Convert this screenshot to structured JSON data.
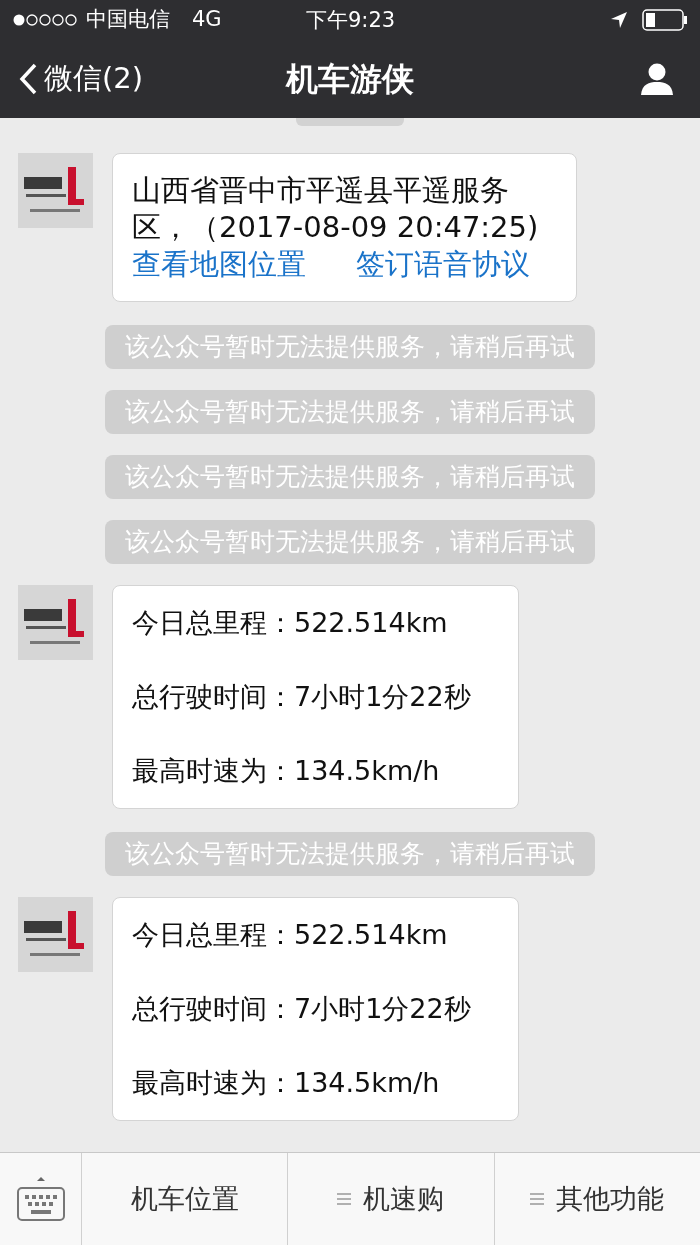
{
  "status_bar": {
    "carrier": "中国电信",
    "network": "4G",
    "time": "下午9:23"
  },
  "nav_bar": {
    "back_label": "微信(2)",
    "title": "机车游侠"
  },
  "messages": [
    {
      "kind": "location",
      "text": "山西省晋中市平遥县平遥服务区，（2017-08-09 20:47:25)",
      "links": [
        "查看地图位置",
        "签订语音协议"
      ]
    },
    {
      "kind": "notice",
      "text": "该公众号暂时无法提供服务，请稍后再试"
    },
    {
      "kind": "notice",
      "text": "该公众号暂时无法提供服务，请稍后再试"
    },
    {
      "kind": "notice",
      "text": "该公众号暂时无法提供服务，请稍后再试"
    },
    {
      "kind": "notice",
      "text": "该公众号暂时无法提供服务，请稍后再试"
    },
    {
      "kind": "stats",
      "lines": [
        "今日总里程：522.514km",
        "总行驶时间：7小时1分22秒",
        "最高时速为：134.5km/h"
      ]
    },
    {
      "kind": "notice",
      "text": "该公众号暂时无法提供服务，请稍后再试"
    },
    {
      "kind": "stats",
      "lines": [
        "今日总里程：522.514km",
        "总行驶时间：7小时1分22秒",
        "最高时速为：134.5km/h"
      ]
    }
  ],
  "menu": [
    {
      "label": "机车位置",
      "submenu": false
    },
    {
      "label": "机速购",
      "submenu": true
    },
    {
      "label": "其他功能",
      "submenu": true
    }
  ]
}
